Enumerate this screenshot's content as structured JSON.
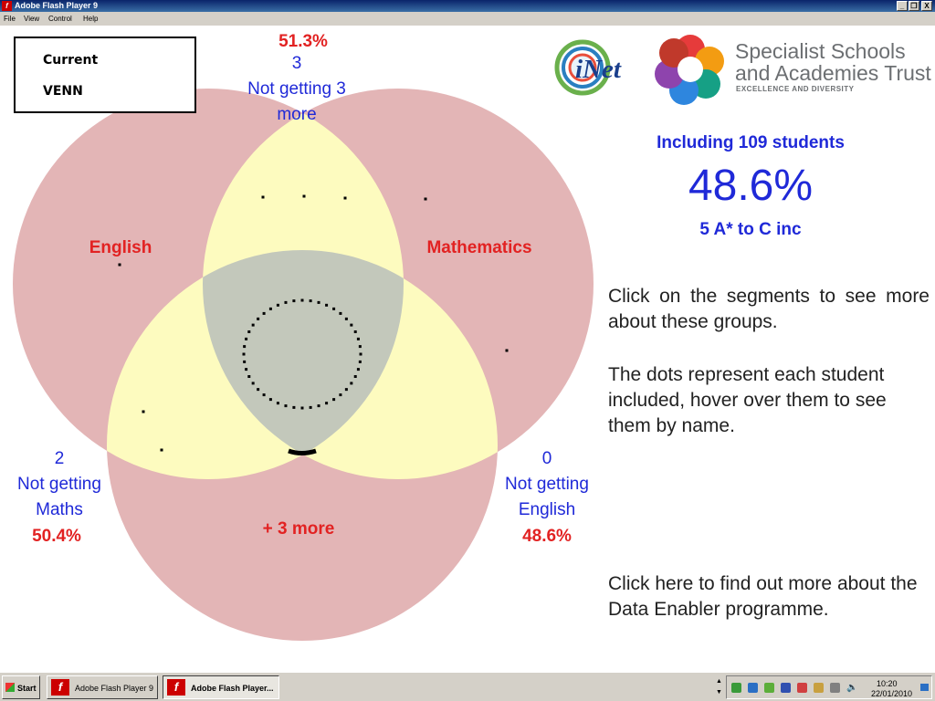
{
  "window": {
    "title": "Adobe Flash Player 9",
    "min": "_",
    "max": "❐",
    "close": "X"
  },
  "menu": [
    "File",
    "View",
    "Control",
    "Help"
  ],
  "current_box": {
    "line1": "Current",
    "line2": "VENN"
  },
  "top_label": {
    "percent": "51.3%",
    "count": "3",
    "line1": "Not getting 3",
    "line2": "more"
  },
  "venn": {
    "english": "English",
    "maths": "Mathematics",
    "bottom": "+ 3 more",
    "colors": {
      "outer": "#e3b5b6",
      "pair": "#fdfbbf",
      "center": "#c3c8bb"
    }
  },
  "left_label": {
    "count": "2",
    "line1": "Not getting",
    "line2": "Maths",
    "percent": "50.4%"
  },
  "right_label": {
    "count": "0",
    "line1": "Not getting",
    "line2": "English",
    "percent": "48.6%"
  },
  "logos": {
    "inet": "iNet",
    "ssat_line1": "Specialist Schools",
    "ssat_line2": "and Academies Trust",
    "ssat_tag": "EXCELLENCE AND DIVERSITY"
  },
  "stats": {
    "including": "Including 109 students",
    "percent": "48.6%",
    "measure": "5 A* to C inc"
  },
  "info": {
    "p1": "Click on the segments to see more about these groups.",
    "p2": "The dots represent each student included, hover over them to see them by name.",
    "p3": "Click here to find out more about the Data Enabler programme."
  },
  "taskbar": {
    "start": "Start",
    "task1": "Adobe Flash Player 9",
    "task2": "Adobe Flash Player...",
    "time": "10:20",
    "date": "22/01/2010"
  }
}
